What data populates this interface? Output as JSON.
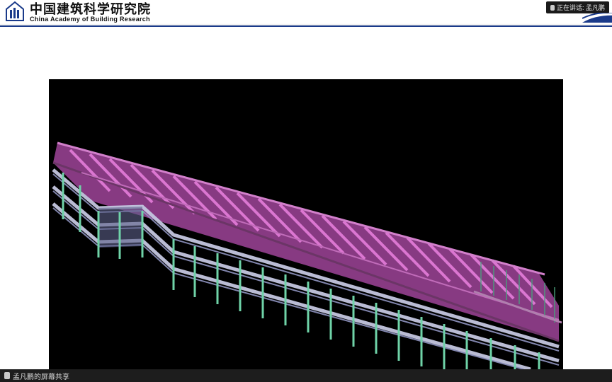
{
  "header": {
    "org_name_cn": "中国建筑科学研究院",
    "org_name_en": "China Academy of Building Research",
    "speaking_label": "正在讲话: 孟凡鹏"
  },
  "footer": {
    "share_status": "孟凡鹏的屏幕共享"
  },
  "model": {
    "description": "3D structural BIM model (isometric), multi-storey elongated building",
    "colors": {
      "roof_panels": "#c95fc1",
      "floor_slab_edge": "#b7b9d0",
      "beams": "#9aa0c8",
      "columns": "#6fd3a8",
      "background": "#000000"
    }
  }
}
